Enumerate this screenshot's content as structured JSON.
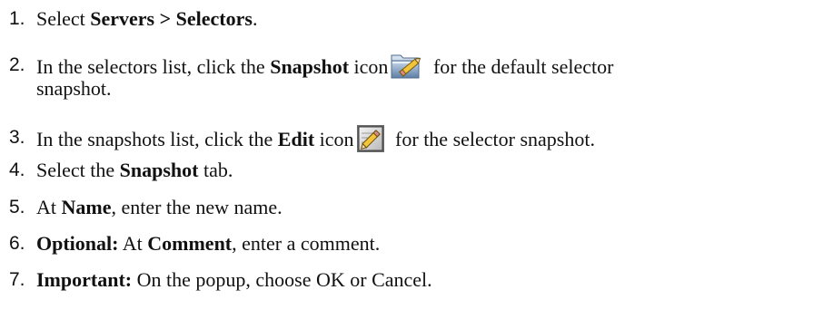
{
  "steps": [
    {
      "num": "1.",
      "parts": [
        "Select ",
        "Servers > Selectors",
        "."
      ]
    },
    {
      "num": "2.",
      "parts": [
        "In the selectors list, click the ",
        "Snapshot",
        " icon",
        " for the default selector",
        "snapshot."
      ],
      "icon": "folder-edit-icon"
    },
    {
      "num": "3.",
      "parts": [
        "In the snapshots list, click the ",
        "Edit",
        " icon",
        " for the selector snapshot."
      ],
      "icon": "edit-pencil-icon"
    },
    {
      "num": "4.",
      "parts": [
        "Select the ",
        "Snapshot",
        " tab."
      ]
    },
    {
      "num": "5.",
      "parts": [
        "At ",
        "Name",
        ", enter the new name."
      ]
    },
    {
      "num": "6.",
      "parts": [
        "Optional:",
        " At ",
        "Comment",
        ", enter a comment."
      ]
    },
    {
      "num": "7.",
      "parts": [
        "Important:",
        " On the popup, choose OK or Cancel."
      ]
    }
  ]
}
